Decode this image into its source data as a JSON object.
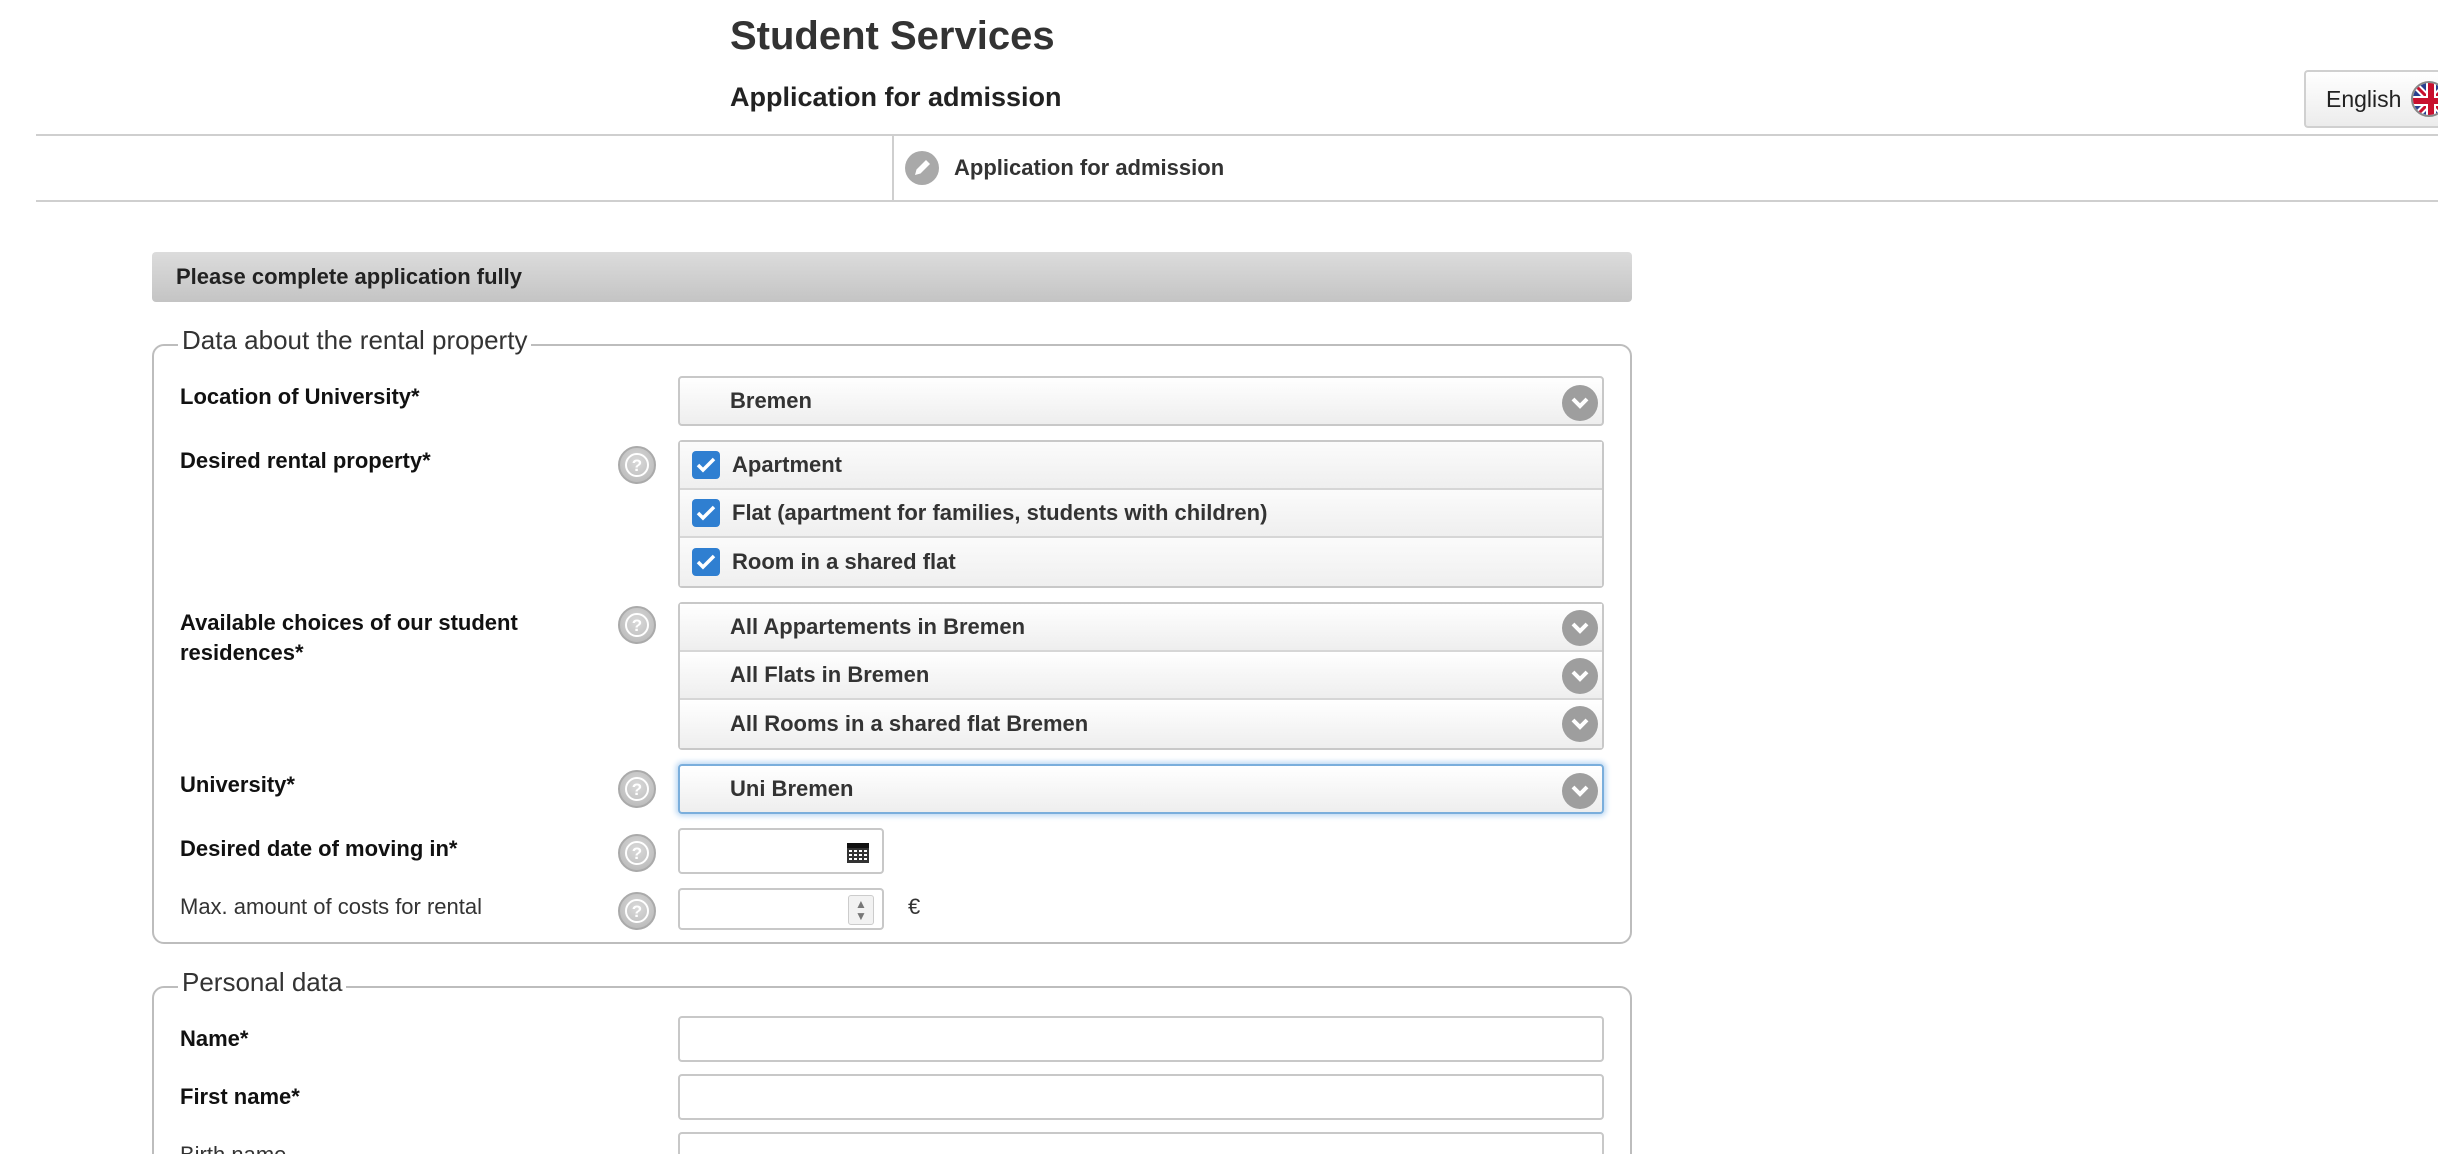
{
  "header": {
    "app_title": "Student Services",
    "subtitle": "Application for admission",
    "language_button": "English"
  },
  "nav": {
    "item_label": "Application for admission"
  },
  "banner": {
    "text": "Please complete application fully"
  },
  "rental_section": {
    "legend": "Data about the rental property",
    "location_label": "Location of University*",
    "location_value": "Bremen",
    "desired_label": "Desired rental property*",
    "desired_options": [
      {
        "label": "Apartment",
        "checked": true
      },
      {
        "label": "Flat (apartment for families, students with children)",
        "checked": true
      },
      {
        "label": "Room in a shared flat",
        "checked": true
      }
    ],
    "residences_label": "Available choices of our student residences*",
    "residences_values": [
      "All Appartements in Bremen",
      "All Flats in Bremen",
      "All Rooms in a shared flat Bremen"
    ],
    "university_label": "University*",
    "university_value": "Uni Bremen",
    "moving_label": "Desired date of moving in*",
    "moving_value": "",
    "max_cost_label": "Max. amount of costs for rental",
    "max_cost_value": "",
    "currency": "€"
  },
  "personal_section": {
    "legend": "Personal data",
    "name_label": "Name*",
    "first_name_label": "First name*",
    "birth_name_label": "Birth name"
  },
  "colors": {
    "checkbox": "#2f7fd1",
    "focus": "#7aaedc",
    "banner": "#cfcfcf"
  }
}
